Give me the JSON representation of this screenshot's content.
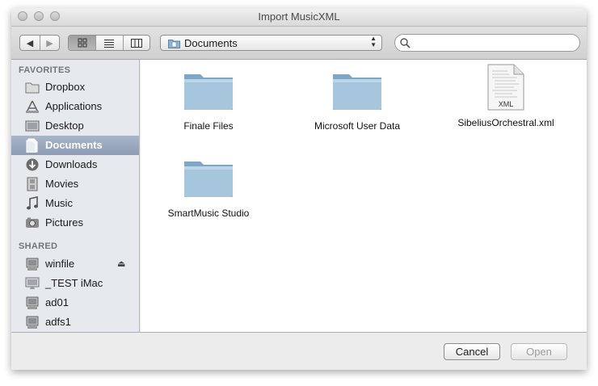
{
  "window": {
    "title": "Import MusicXML"
  },
  "toolbar": {
    "path_label": "Documents",
    "search_placeholder": ""
  },
  "sidebar": {
    "favorites_header": "FAVORITES",
    "favorites": [
      {
        "label": "Dropbox",
        "icon": "folder-icon"
      },
      {
        "label": "Applications",
        "icon": "applications-icon"
      },
      {
        "label": "Desktop",
        "icon": "desktop-icon"
      },
      {
        "label": "Documents",
        "icon": "documents-icon",
        "selected": true
      },
      {
        "label": "Downloads",
        "icon": "downloads-icon"
      },
      {
        "label": "Movies",
        "icon": "movies-icon"
      },
      {
        "label": "Music",
        "icon": "music-icon"
      },
      {
        "label": "Pictures",
        "icon": "pictures-icon"
      }
    ],
    "shared_header": "SHARED",
    "shared": [
      {
        "label": "winfile",
        "icon": "network-computer-icon",
        "eject": true
      },
      {
        "label": "_TEST iMac",
        "icon": "imac-icon"
      },
      {
        "label": "ad01",
        "icon": "network-computer-icon"
      },
      {
        "label": "adfs1",
        "icon": "network-computer-icon"
      }
    ]
  },
  "files": [
    {
      "name": "Finale Files",
      "icon": "folder-icon"
    },
    {
      "name": "Microsoft User Data",
      "icon": "folder-icon"
    },
    {
      "name": "SibeliusOrchestral.xml",
      "icon": "xml-document-icon",
      "badge": "XML"
    },
    {
      "name": "SmartMusic Studio",
      "icon": "folder-icon"
    }
  ],
  "buttons": {
    "cancel": "Cancel",
    "open": "Open"
  },
  "colors": {
    "selection": "#8d9cb5",
    "folder": "#8fb4d0"
  }
}
